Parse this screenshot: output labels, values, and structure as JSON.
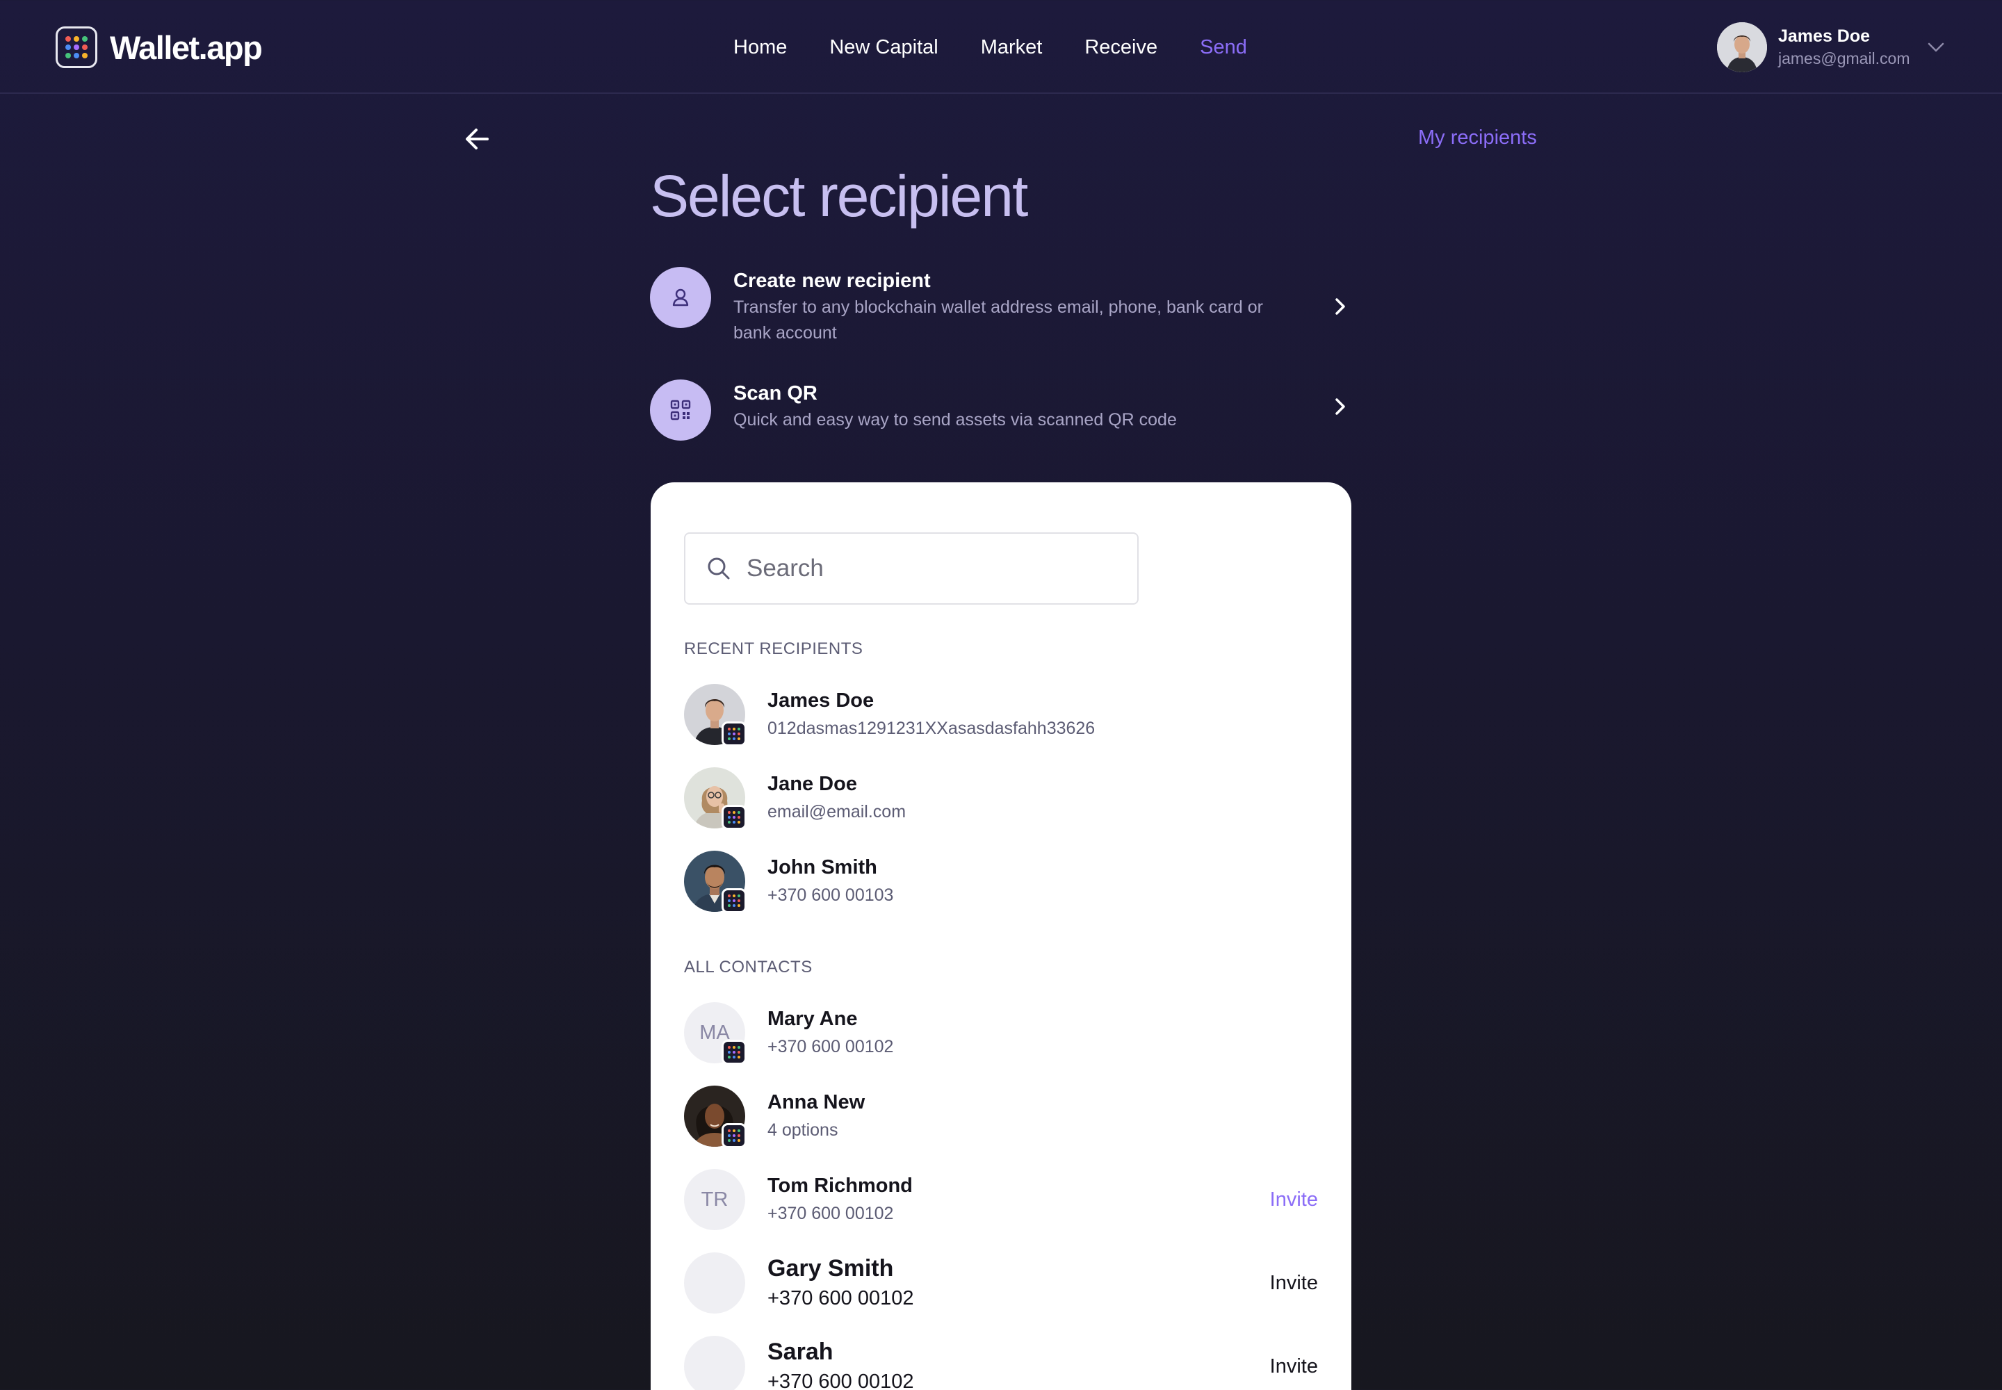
{
  "app": {
    "name": "Wallet.app"
  },
  "nav": {
    "items": [
      {
        "label": "Home",
        "active": false
      },
      {
        "label": "New Capital",
        "active": false
      },
      {
        "label": "Market",
        "active": false
      },
      {
        "label": "Receive",
        "active": false
      },
      {
        "label": "Send",
        "active": true
      }
    ]
  },
  "user": {
    "name": "James Doe",
    "email": "james@gmail.com"
  },
  "page": {
    "title": "Select recipient",
    "my_recipients_link": "My recipients"
  },
  "options": [
    {
      "title": "Create new recipient",
      "description": "Transfer to any blockchain wallet address email, phone, bank card or bank account",
      "icon": "person-icon"
    },
    {
      "title": "Scan QR",
      "description": "Quick and easy way to send assets via scanned QR code",
      "icon": "qr-code-icon"
    }
  ],
  "search": {
    "placeholder": "Search"
  },
  "recent": {
    "label": "RECENT RECIPIENTS",
    "items": [
      {
        "name": "James Doe",
        "detail": "012dasmas1291231XXasasdasfahh33626"
      },
      {
        "name": "Jane Doe",
        "detail": "email@email.com"
      },
      {
        "name": "John Smith",
        "detail": "+370 600 00103"
      }
    ]
  },
  "contacts": {
    "label": "ALL CONTACTS",
    "items": [
      {
        "name": "Mary Ane",
        "detail": "+370 600 00102",
        "initials": "MA"
      },
      {
        "name": "Anna New",
        "detail": "4 options"
      },
      {
        "name": "Tom Richmond",
        "detail": "+370 600 00102",
        "initials": "TR",
        "action": "Invite"
      },
      {
        "name": "Gary Smith",
        "detail": "+370 600 00102",
        "action": "Invite"
      },
      {
        "name": "Sarah",
        "detail": "+370 600 00102",
        "action": "Invite"
      }
    ]
  },
  "colors": {
    "accent": "#8b6df7",
    "background_top": "#1d1a3c",
    "background_bottom": "#17171f",
    "title": "#c7bff0",
    "option_icon_bg": "#c7bcf3",
    "logo_dots": [
      "#f25c54",
      "#f7b32b",
      "#46c37b",
      "#4c8df6",
      "#a66cff",
      "#f25c54",
      "#46c37b",
      "#4c8df6",
      "#f7b32b"
    ]
  }
}
